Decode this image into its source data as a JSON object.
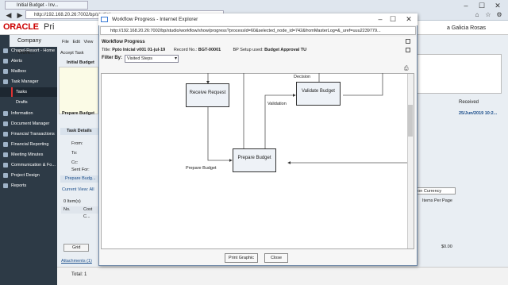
{
  "back_browser": {
    "address": "http://192.168.20.26:7002/bp/studio/",
    "tab_title": "Initial Budget - Inv...",
    "user": "a Galicia Rosas"
  },
  "oracle": {
    "logo": "ORACLE",
    "product": "Pri"
  },
  "sidebar": {
    "header": "Chapel-Resort - Home",
    "company_tab": "Company Work...",
    "items": [
      {
        "label": "Chapel-Resort - Home"
      },
      {
        "label": "Alerts"
      },
      {
        "label": "Mailbox"
      },
      {
        "label": "Task Manager"
      },
      {
        "label": "Tasks"
      },
      {
        "label": "Drafts"
      },
      {
        "label": "Information"
      },
      {
        "label": "Document Manager"
      },
      {
        "label": "Financial Transactions"
      },
      {
        "label": "Financial Reporting"
      },
      {
        "label": "Meeting Minutes"
      },
      {
        "label": "Communication & Fo..."
      },
      {
        "label": "Project Design"
      },
      {
        "label": "Reports"
      }
    ]
  },
  "back_content": {
    "menu": [
      "File",
      "Edit",
      "View"
    ],
    "accept_task": "Accept Task",
    "initial_budget": "Initial Budget",
    "prepare_budget": "Prepare Budget",
    "task_details": "Task Details",
    "from": "From:",
    "to": "To:",
    "cc": "Cc:",
    "sent_for": "Sent For:",
    "prepare_budg": "Prepare Budg...",
    "current_view": "Current View:",
    "current_view_value": "All",
    "items_count": "0  Item(s)",
    "col_no": "No.",
    "col_cost": "Cost C...",
    "grid_btn": "Grid",
    "attachments": "Attachments (1)",
    "received_header": "Received",
    "received_value": "25/Jun/2019 10:2...",
    "currency": "ion Currency",
    "items_per_page": "Items Per Page",
    "amount": "$0.00",
    "total": "Total: 1"
  },
  "popup": {
    "title": "Workflow Progress - Internet Explorer",
    "address": "http://192.168.20.26:7002/bp/studio/workflow/show/progress?processId=60&selected_node_id=742&fromMasterLog=&_uref=uuu2239779...",
    "heading": "Workflow Progress",
    "title_label": "Title:",
    "title_value": "Ppto Inicial v001 01-jul-19",
    "record_label": "Record No.:",
    "record_value": "BGT-00001",
    "setup_label": "BP Setup used:",
    "setup_value": "Budget Approval TU",
    "filter_label": "Filter By:",
    "filter_value": "Visited Steps",
    "diagram": {
      "nodes": [
        {
          "label": "Receive Request"
        },
        {
          "label": "Validate Budget"
        },
        {
          "label": "Prepare Budget"
        }
      ],
      "edge_labels": [
        "Decision",
        "Validation",
        "Prepare Budget"
      ]
    },
    "print_graphic": "Print Graphic",
    "close": "Close"
  }
}
